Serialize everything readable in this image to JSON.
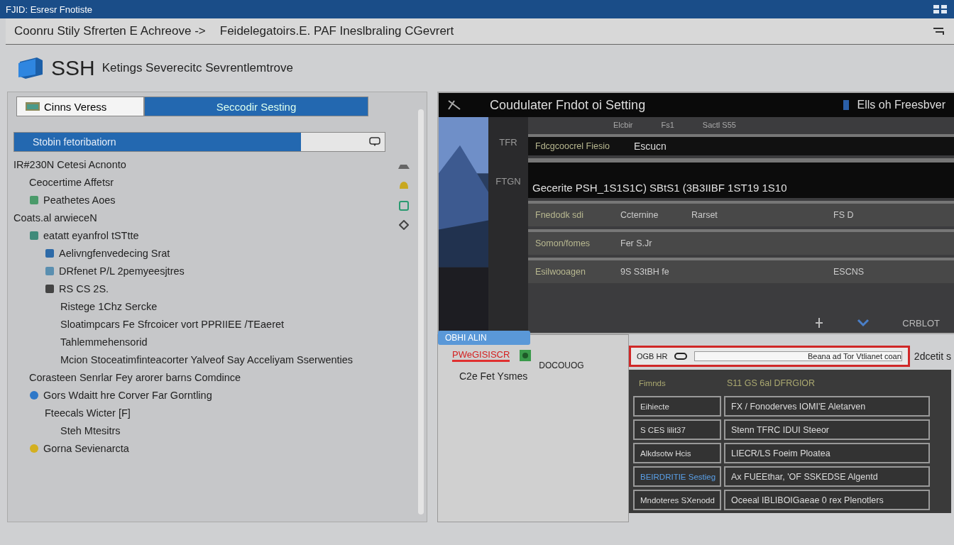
{
  "window": {
    "title": "FJID: Esresr Fnotiste"
  },
  "breadcrumb": {
    "path": "Coonru Stily Sfrerten  E Achreove ->",
    "current": "Feidelegatoirs.E. PAF Ineslbraling CGevrert"
  },
  "header": {
    "title": "SSH",
    "subtitle": "Ketings Severecitc Sevrentlemtrove"
  },
  "left_panel": {
    "tabs": [
      {
        "label": "Cinns Veress",
        "selected": false
      },
      {
        "label": "Seccodir Sesting",
        "selected": true
      }
    ],
    "search": {
      "value": "Stobin fetoribatiorn"
    },
    "tree": [
      {
        "label": "IR#230N Cetesi Acnonto",
        "children": [
          {
            "label": "Ceocertime Affetsr"
          },
          {
            "label": "Peathetes Aoes"
          }
        ]
      },
      {
        "label": "Coats.al arwieceN",
        "children": [
          {
            "label": "eatatt eyanfrol tSTtte",
            "kind": "folder",
            "children": [
              {
                "label": "Aelivngfenvedecing Srat",
                "kind": "doc"
              },
              {
                "label": "DRfenet P/L 2pemyeesjtres",
                "kind": "stack"
              },
              {
                "label": "RS CS 2S.",
                "kind": "page",
                "children": [
                  {
                    "label": "Ristege 1Chz Sercke"
                  },
                  {
                    "label": "Sloatimpcars Fe Sfrcoicer vort PPRIIEE /TEaeret"
                  },
                  {
                    "label": "Tahlemmehensorid"
                  },
                  {
                    "label": "Mcion Stoceatimfinteacorter Yalveof Say Acceliyam Sserwenties"
                  }
                ]
              }
            ]
          },
          {
            "label": "Corasteen Senrlar Fey arorer barns Comdince"
          },
          {
            "label": "Gors Wdaitt hre Corver Far Gorntling",
            "kind": "globe",
            "children": [
              {
                "label": "Fteecals Wicter [F]",
                "children": [
                  {
                    "label": "Steh Mtesitrs"
                  }
                ]
              }
            ]
          },
          {
            "label": "Gorna Sevienarcta",
            "kind": "key"
          }
        ]
      }
    ]
  },
  "detail_panel": {
    "title": "Coudulater Fndot oi Setting",
    "action": "Ells oh Freesbver",
    "side_labels": [
      "TFR",
      "FTGN"
    ],
    "top_tabs": [
      "Elcbir",
      "Fs1",
      "Sactl S55"
    ],
    "field": {
      "label": "Fdcgcoocrel Fiesio",
      "value": "Escucn"
    },
    "command": "Gecerite PSH_1S1S1C) SBtS1 (3B3IIBF 1ST19 1S10",
    "rows": [
      {
        "cells": [
          "Fnedodk sdi",
          "Ccternine",
          "Rarset",
          "FS D"
        ]
      },
      {
        "cells": [
          "Somon/fomes",
          "Fer S.Jr",
          "",
          ""
        ]
      },
      {
        "cells": [
          "Esilwooagen",
          "9S S3tBH fe",
          "",
          "ESCNS"
        ]
      }
    ],
    "footer": "CRBLOT"
  },
  "lower_left": {
    "tab": "OBHI ALIN",
    "alert": "PWeGISISCR",
    "note": "C2e Fet Ysmes",
    "caption": "DOCOUOG"
  },
  "connection": {
    "label": "OGB HR",
    "value": "Beana ad Tor Vtlianet coan",
    "side": "2dcetit s"
  },
  "table": {
    "header": [
      "Fimnds",
      "S11 GS 6al DFRGIOR"
    ],
    "rows": [
      {
        "cells": [
          "Eihiecte",
          "FX / Fonoderves IOMI'E Aletarven"
        ],
        "selected": false
      },
      {
        "cells": [
          "S CES lilit37",
          "Stenn TFRC IDUI Steeor"
        ],
        "selected": false
      },
      {
        "cells": [
          "Alkdsotw Hcis",
          "LIECR/LS Foeim Ploatea"
        ],
        "selected": false
      },
      {
        "cells": [
          "BEIRDRITIE Sestieg",
          "Ax FUEEthar, 'OF SSKEDSE Algentd"
        ],
        "selected": true
      },
      {
        "cells": [
          "Mndoteres SXenodd",
          "Oceeal  IBLIBOIGaeae 0 rex Plenotlers"
        ],
        "selected": false
      }
    ]
  }
}
